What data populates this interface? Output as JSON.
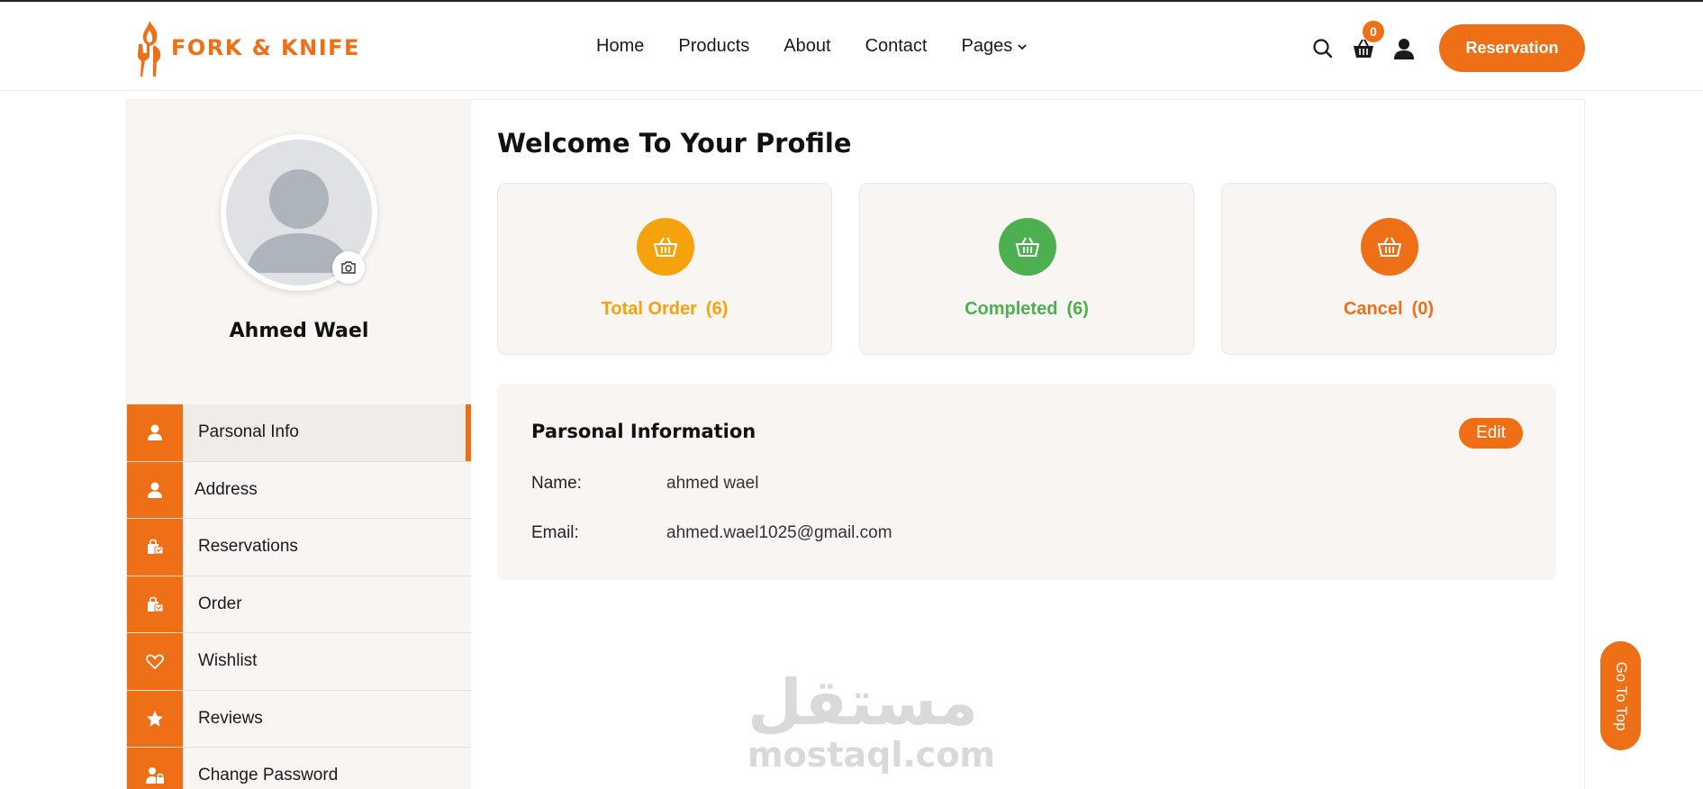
{
  "brand": {
    "name": "FORK & KNIFE",
    "accent": "#ee6f16"
  },
  "nav": {
    "items": [
      "Home",
      "Products",
      "About",
      "Contact",
      "Pages"
    ]
  },
  "header": {
    "cart_count": "0",
    "reservation_label": "Reservation",
    "icons": [
      "search-icon",
      "cart-icon",
      "user-icon"
    ]
  },
  "profile": {
    "name": "Ahmed Wael"
  },
  "sidebar": {
    "items": [
      {
        "label": "Parsonal Info",
        "icon": "user-icon",
        "active": true
      },
      {
        "label": "Address",
        "icon": "user-icon",
        "active": false
      },
      {
        "label": "Reservations",
        "icon": "bag-icon",
        "active": false
      },
      {
        "label": "Order",
        "icon": "bag-icon",
        "active": false
      },
      {
        "label": "Wishlist",
        "icon": "heart-icon",
        "active": false
      },
      {
        "label": "Reviews",
        "icon": "star-icon",
        "active": false
      },
      {
        "label": "Change Password",
        "icon": "user-lock-icon",
        "active": false
      }
    ]
  },
  "main": {
    "welcome": "Welcome To Your Profile",
    "stats": [
      {
        "label": "Total Order",
        "count": "(6)",
        "color": "#f6a20c"
      },
      {
        "label": "Completed",
        "count": "(6)",
        "color": "#4caf50"
      },
      {
        "label": "Cancel",
        "count": "(0)",
        "color": "#ee6f16"
      }
    ],
    "info": {
      "title": "Parsonal Information",
      "edit_label": "Edit",
      "name_label": "Name:",
      "name_value": "ahmed wael",
      "email_label": "Email:",
      "email_value": "ahmed.wael1025@gmail.com"
    }
  },
  "watermark": {
    "arabic": "مستقل",
    "latin": "mostaql.com"
  },
  "go_top_label": "Go To Top"
}
